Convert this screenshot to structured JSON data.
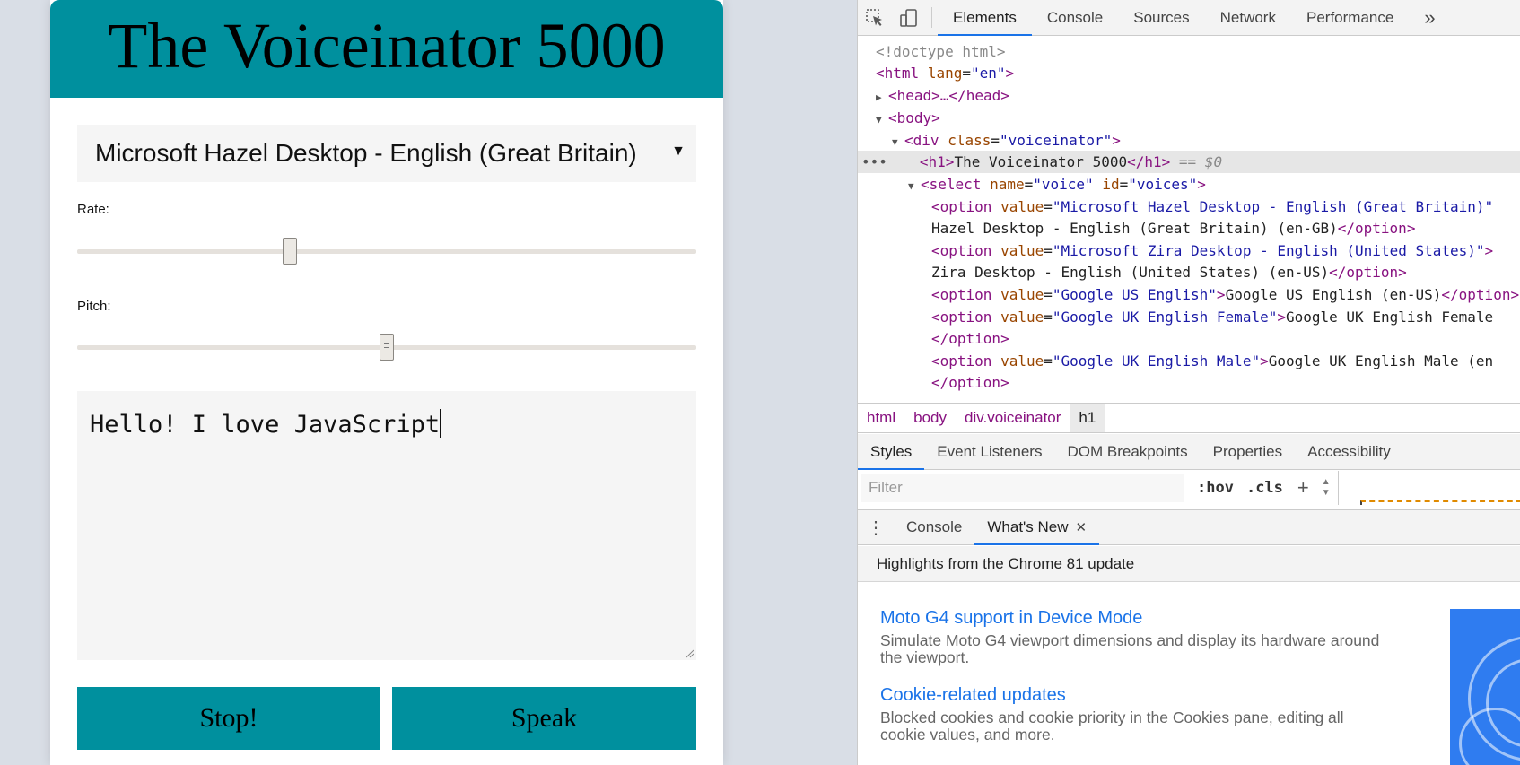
{
  "app": {
    "title": "The Voiceinator 5000",
    "voice_selected": "Microsoft Hazel Desktop - English (Great Britain)",
    "rate_label": "Rate:",
    "rate_value_fraction": 0.34,
    "pitch_label": "Pitch:",
    "pitch_value_fraction": 0.5,
    "text_value": "Hello! I love JavaScript",
    "stop_label": "Stop!",
    "speak_label": "Speak",
    "accent_color": "#00909e"
  },
  "devtools": {
    "tabs": [
      "Elements",
      "Console",
      "Sources",
      "Network",
      "Performance"
    ],
    "more_tabs_glyph": "»",
    "dom": {
      "doctype": "<!doctype html>",
      "html_tag": "html",
      "html_attr": "lang",
      "html_attr_val": "\"en\"",
      "head_collapsed": "<head>…</head>",
      "body_tag": "<body>",
      "div_tag": "div",
      "div_attr": "class",
      "div_attr_val": "\"voiceinator\"",
      "h1_text": "The Voiceinator 5000",
      "h1_marker": "== $0",
      "select_attr1": "name",
      "select_val1": "\"voice\"",
      "select_attr2": "id",
      "select_val2": "\"voices\"",
      "options": [
        {
          "value": "\"Microsoft Hazel Desktop - English (Great Britain)\"",
          "text": "Hazel Desktop - English (Great Britain) (en-GB)"
        },
        {
          "value": "\"Microsoft Zira Desktop - English (United States)\"",
          "text": "Zira Desktop - English (United States) (en-US)"
        },
        {
          "value": "\"Google US English\"",
          "text": "Google US English (en-US)"
        },
        {
          "value": "\"Google UK English Female\"",
          "text": "Google UK English Female"
        },
        {
          "value": "\"Google UK English Male\"",
          "text": "Google UK English Male (en"
        }
      ]
    },
    "breadcrumbs": [
      "html",
      "body",
      "div.voiceinator",
      "h1"
    ],
    "style_tabs": [
      "Styles",
      "Event Listeners",
      "DOM Breakpoints",
      "Properties",
      "Accessibility"
    ],
    "filter_placeholder": "Filter",
    "hov_label": ":hov",
    "cls_label": ".cls",
    "drawer_tabs": [
      "Console",
      "What's New"
    ],
    "whats_new_header": "Highlights from the Chrome 81 update",
    "features": [
      {
        "title": "Moto G4 support in Device Mode",
        "desc": "Simulate Moto G4 viewport dimensions and display its hardware around the viewport."
      },
      {
        "title": "Cookie-related updates",
        "desc": "Blocked cookies and cookie priority in the Cookies pane, editing all cookie values, and more."
      }
    ]
  }
}
